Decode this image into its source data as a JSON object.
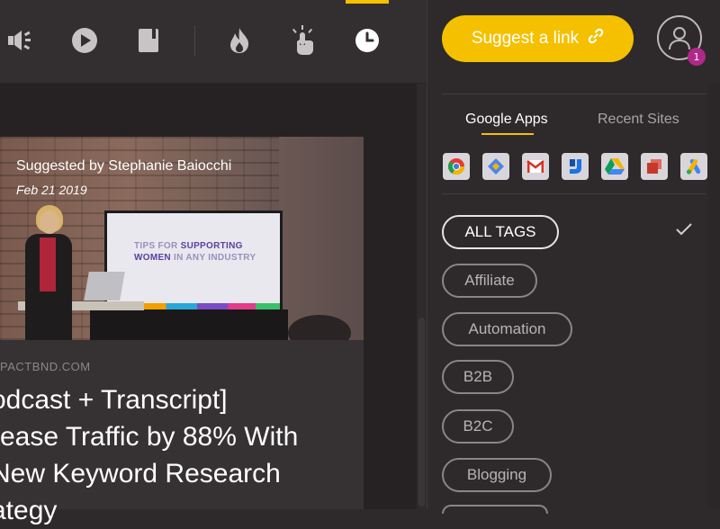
{
  "nav": {
    "icons": [
      "volume-icon",
      "play-icon",
      "book-icon",
      "fire-icon",
      "tap-icon",
      "clock-icon"
    ],
    "active": "clock-icon",
    "accent_color": "#f5c000"
  },
  "card": {
    "suggested_by": "Suggested by Stephanie Baiocchi",
    "date": "Feb 21 2019",
    "slide_line1_a": "TIPS FOR ",
    "slide_line1_b": "SUPPORTING",
    "slide_line2_a": "WOMEN",
    "slide_line2_b": " IN ANY INDUSTRY",
    "domain": "PACTBND.COM",
    "title_line1": "odcast + Transcript]",
    "title_line2": "rease Traffic by 88% With",
    "title_line3": "New Keyword Research",
    "title_line4": "ategy"
  },
  "sidebar": {
    "suggest_label": "Suggest a link",
    "notification_count": "1",
    "tabs": [
      {
        "label": "Google Apps",
        "active": true
      },
      {
        "label": "Recent Sites",
        "active": false
      }
    ],
    "apps": [
      "chrome-icon",
      "google-ads-diamond-icon",
      "gmail-icon",
      "jamboard-icon",
      "google-drive-icon",
      "google-slides-icon",
      "google-ads-icon"
    ],
    "tags": [
      {
        "label": "ALL TAGS",
        "selected": true
      },
      {
        "label": "Affiliate",
        "selected": false
      },
      {
        "label": "Automation",
        "selected": false
      },
      {
        "label": "B2B",
        "selected": false
      },
      {
        "label": "B2C",
        "selected": false
      },
      {
        "label": "Blogging",
        "selected": false
      }
    ]
  }
}
